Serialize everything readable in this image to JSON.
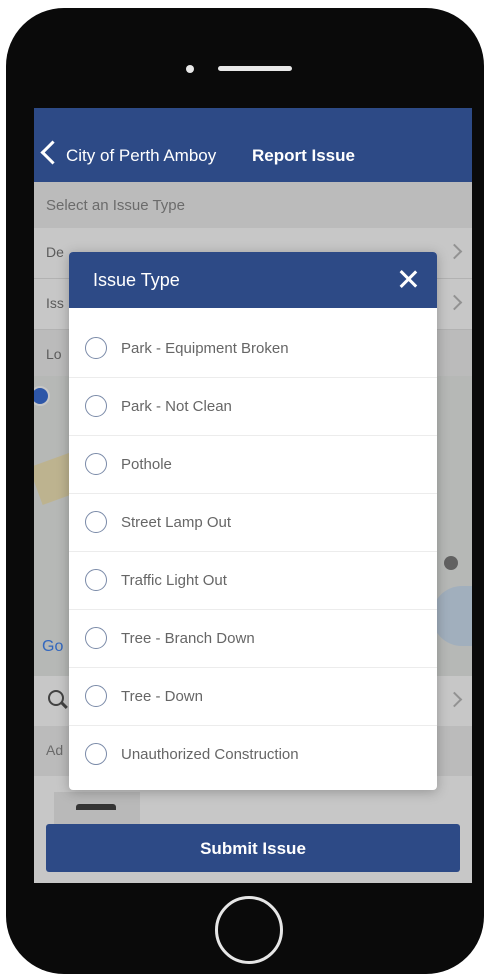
{
  "nav": {
    "back_label": "City of Perth Amboy",
    "title": "Report Issue"
  },
  "form": {
    "section_header": "Select an Issue Type",
    "row1_label": "De",
    "row2_label": "Iss",
    "row3_label": "Lo",
    "add_label": "Ad"
  },
  "map": {
    "google_label": "Go"
  },
  "modal": {
    "title": "Issue Type",
    "options": [
      "Park - Equipment Broken",
      "Park - Not Clean",
      "Pothole",
      "Street Lamp Out",
      "Traffic Light Out",
      "Tree - Branch Down",
      "Tree - Down",
      "Unauthorized Construction"
    ]
  },
  "submit_label": "Submit Issue",
  "colors": {
    "brand": "#2d4a86",
    "phone_body": "#0a0a0a"
  }
}
